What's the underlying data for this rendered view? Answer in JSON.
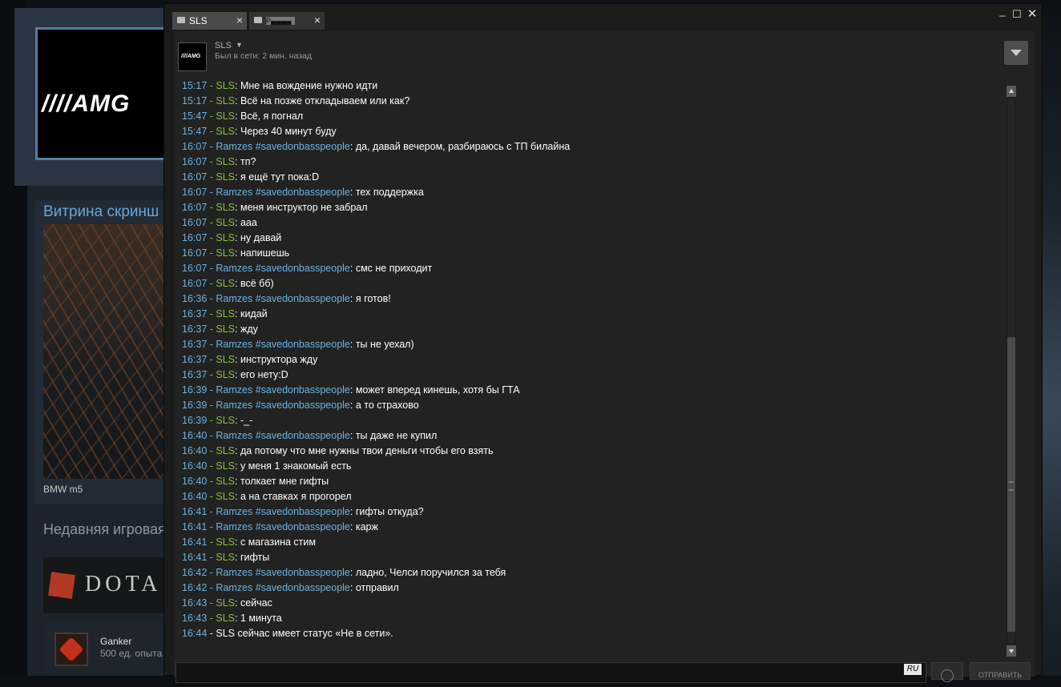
{
  "background": {
    "avatar_logo": "////AMG",
    "showcase_title": "Витрина скринш",
    "showcase_caption": "BMW m5",
    "recent_title": "Недавняя игровая",
    "game_banner_text": "DOTA",
    "achievement_name": "Ganker",
    "achievement_sub": "500 ед. опыта"
  },
  "chat": {
    "tabs": [
      {
        "label": "SLS"
      },
      {
        "label": "P▄▄▄▄"
      }
    ],
    "window_controls": {
      "minimize": "_",
      "maximize": "☐",
      "close": "✕"
    },
    "friend": {
      "name": "SLS",
      "avatar_logo": "////AMG",
      "status": "Был в сети: 2 мин. назад"
    },
    "messages": [
      {
        "time": "15:17",
        "author": "SLS",
        "hashtag": "",
        "text": "Мне на вождение нужно идти"
      },
      {
        "time": "15:17",
        "author": "SLS",
        "hashtag": "",
        "text": "Всё на позже откладываем или как?"
      },
      {
        "time": "15:47",
        "author": "SLS",
        "hashtag": "",
        "text": "Всё, я погнал"
      },
      {
        "time": "15:47",
        "author": "SLS",
        "hashtag": "",
        "text": "Через 40 минут буду"
      },
      {
        "time": "16:07",
        "author": "Ramzes",
        "hashtag": "#savedonbasspeople",
        "text": "да, давай вечером, разбираюсь с ТП билайна"
      },
      {
        "time": "16:07",
        "author": "SLS",
        "hashtag": "",
        "text": "тп?"
      },
      {
        "time": "16:07",
        "author": "SLS",
        "hashtag": "",
        "text": "я ещё тут пока:D"
      },
      {
        "time": "16:07",
        "author": "Ramzes",
        "hashtag": "#savedonbasspeople",
        "text": "тех поддержка"
      },
      {
        "time": "16:07",
        "author": "SLS",
        "hashtag": "",
        "text": "меня инструктор не забрал"
      },
      {
        "time": "16:07",
        "author": "SLS",
        "hashtag": "",
        "text": "ааа"
      },
      {
        "time": "16:07",
        "author": "SLS",
        "hashtag": "",
        "text": "ну давай"
      },
      {
        "time": "16:07",
        "author": "SLS",
        "hashtag": "",
        "text": "напишешь"
      },
      {
        "time": "16:07",
        "author": "Ramzes",
        "hashtag": "#savedonbasspeople",
        "text": "смс не приходит"
      },
      {
        "time": "16:07",
        "author": "SLS",
        "hashtag": "",
        "text": "всё бб)"
      },
      {
        "time": "16:36",
        "author": "Ramzes",
        "hashtag": "#savedonbasspeople",
        "text": "я готов!"
      },
      {
        "time": "16:37",
        "author": "SLS",
        "hashtag": "",
        "text": "кидай"
      },
      {
        "time": "16:37",
        "author": "SLS",
        "hashtag": "",
        "text": "жду"
      },
      {
        "time": "16:37",
        "author": "Ramzes",
        "hashtag": "#savedonbasspeople",
        "text": "ты не уехал)"
      },
      {
        "time": "16:37",
        "author": "SLS",
        "hashtag": "",
        "text": "инструктора жду"
      },
      {
        "time": "16:37",
        "author": "SLS",
        "hashtag": "",
        "text": "его нету:D"
      },
      {
        "time": "16:39",
        "author": "Ramzes",
        "hashtag": "#savedonbasspeople",
        "text": "может вперед кинешь, хотя бы ГТА"
      },
      {
        "time": "16:39",
        "author": "Ramzes",
        "hashtag": "#savedonbasspeople",
        "text": "а то страхово"
      },
      {
        "time": "16:39",
        "author": "SLS",
        "hashtag": "",
        "text": "-_-"
      },
      {
        "time": "16:40",
        "author": "Ramzes",
        "hashtag": "#savedonbasspeople",
        "text": "ты даже не купил"
      },
      {
        "time": "16:40",
        "author": "SLS",
        "hashtag": "",
        "text": "да потому что мне нужны твои деньги чтобы его взять"
      },
      {
        "time": "16:40",
        "author": "SLS",
        "hashtag": "",
        "text": "у меня 1 знакомый есть"
      },
      {
        "time": "16:40",
        "author": "SLS",
        "hashtag": "",
        "text": "толкает мне гифты"
      },
      {
        "time": "16:40",
        "author": "SLS",
        "hashtag": "",
        "text": "а на ставках я прогорел"
      },
      {
        "time": "16:41",
        "author": "Ramzes",
        "hashtag": "#savedonbasspeople",
        "text": "гифты откуда?"
      },
      {
        "time": "16:41",
        "author": "Ramzes",
        "hashtag": "#savedonbasspeople",
        "text": "карж"
      },
      {
        "time": "16:41",
        "author": "SLS",
        "hashtag": "",
        "text": "с магазина стим"
      },
      {
        "time": "16:41",
        "author": "SLS",
        "hashtag": "",
        "text": "гифты"
      },
      {
        "time": "16:42",
        "author": "Ramzes",
        "hashtag": "#savedonbasspeople",
        "text": "ладно, Челси поручился за тебя"
      },
      {
        "time": "16:42",
        "author": "Ramzes",
        "hashtag": "#savedonbasspeople",
        "text": "отправил"
      },
      {
        "time": "16:43",
        "author": "SLS",
        "hashtag": "",
        "text": "сейчас"
      },
      {
        "time": "16:43",
        "author": "SLS",
        "hashtag": "",
        "text": "1 минута"
      }
    ],
    "system_message": {
      "time": "16:44",
      "text": "SLS сейчас имеет статус «Не в сети»."
    },
    "input": {
      "value": "",
      "lang": "RU"
    },
    "send_label": "ОТПРАВИТЬ",
    "colors": {
      "time": "#6cb2e0",
      "sls": "#8cbe3c",
      "ramzes": "#6cb2e0",
      "text": "#ffffff"
    }
  }
}
